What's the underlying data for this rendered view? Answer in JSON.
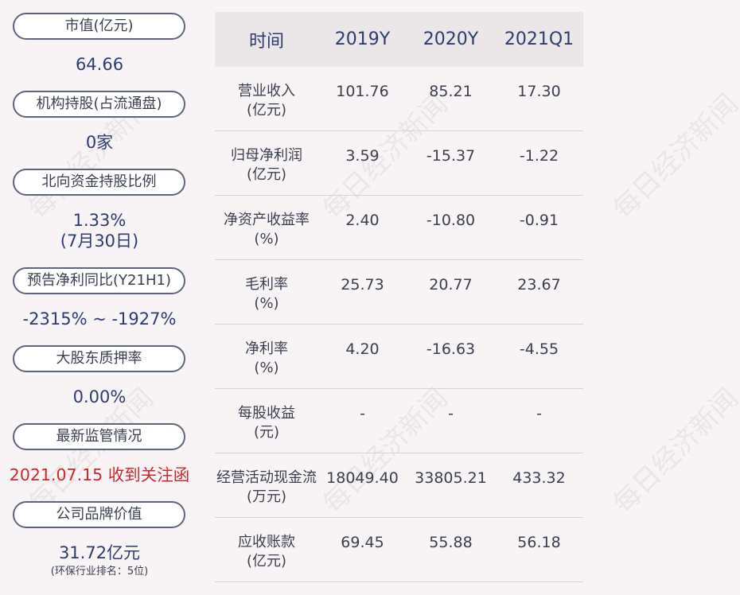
{
  "left_panel": {
    "items": [
      {
        "label": "市值(亿元)",
        "value": "64.66"
      },
      {
        "label": "机构持股(占流通盘)",
        "value": "0家"
      },
      {
        "label": "北向资金持股比例",
        "value": "1.33%",
        "value2": "(7月30日)"
      },
      {
        "label": "预告净利同比(Y21H1)",
        "value": "-2315% ~ -1927%"
      },
      {
        "label": "大股东质押率",
        "value": "0.00%"
      },
      {
        "label": "最新监管情况",
        "value": "2021.07.15 收到关注函"
      },
      {
        "label": "公司品牌价值",
        "value": "31.72亿元",
        "note": "(环保行业排名：5位)"
      }
    ]
  },
  "table": {
    "headers": [
      "时间",
      "2019Y",
      "2020Y",
      "2021Q1"
    ],
    "rows": [
      {
        "label1": "营业收入",
        "label2": "(亿元)",
        "values": [
          "101.76",
          "85.21",
          "17.30"
        ]
      },
      {
        "label1": "归母净利润",
        "label2": "(亿元)",
        "values": [
          "3.59",
          "-15.37",
          "-1.22"
        ]
      },
      {
        "label1": "净资产收益率",
        "label2": "(%)",
        "values": [
          "2.40",
          "-10.80",
          "-0.91"
        ]
      },
      {
        "label1": "毛利率",
        "label2": "(%)",
        "values": [
          "25.73",
          "20.77",
          "23.67"
        ]
      },
      {
        "label1": "净利率",
        "label2": "(%)",
        "values": [
          "4.20",
          "-16.63",
          "-4.55"
        ]
      },
      {
        "label1": "每股收益",
        "label2": "(元)",
        "values": [
          "-",
          "-",
          "-"
        ]
      },
      {
        "label1": "经营活动现金流",
        "label2": "(万元)",
        "values": [
          "18049.40",
          "33805.21",
          "433.32"
        ]
      },
      {
        "label1": "应收账款",
        "label2": "(亿元)",
        "values": [
          "69.45",
          "55.88",
          "56.18"
        ]
      }
    ]
  },
  "watermark": "每日经济新闻",
  "colors": {
    "accent": "#2c3c6e",
    "alert": "#d0262e",
    "header_bg": "#ebe6e8",
    "background": "#f8f4f5"
  }
}
